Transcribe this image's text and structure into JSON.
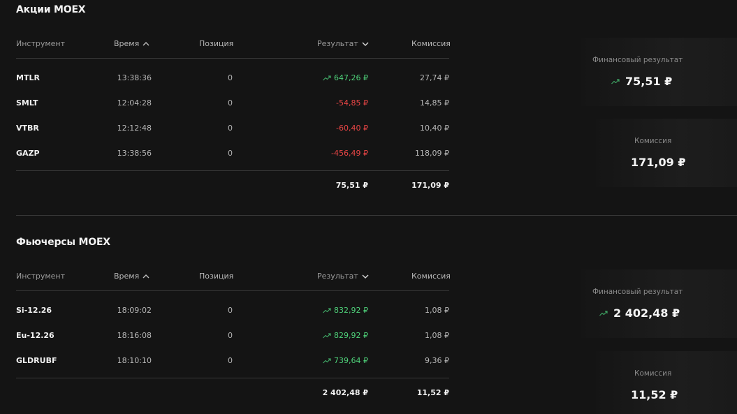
{
  "colors": {
    "positive": "#4fd27a",
    "negative": "#ec4646",
    "background": "#141414"
  },
  "icons": {
    "trend": "trend-up-icon",
    "sort_up": "chevron-up-icon",
    "sort_down": "chevron-down-icon"
  },
  "sections": [
    {
      "title": "Акции MOEX",
      "headers": {
        "instrument": "Инструмент",
        "time": "Время",
        "position": "Позиция",
        "result": "Результат",
        "commission": "Комиссия"
      },
      "rows": [
        {
          "instrument": "MTLR",
          "time": "13:38:36",
          "position": "0",
          "result": "647,26 ₽",
          "sign": "pos",
          "commission": "27,74 ₽"
        },
        {
          "instrument": "SMLT",
          "time": "12:04:28",
          "position": "0",
          "result": "-54,85 ₽",
          "sign": "neg",
          "commission": "14,85 ₽"
        },
        {
          "instrument": "VTBR",
          "time": "12:12:48",
          "position": "0",
          "result": "-60,40 ₽",
          "sign": "neg",
          "commission": "10,40 ₽"
        },
        {
          "instrument": "GAZP",
          "time": "13:38:56",
          "position": "0",
          "result": "-456,49 ₽",
          "sign": "neg",
          "commission": "118,09 ₽"
        }
      ],
      "totals": {
        "result": "75,51 ₽",
        "commission": "171,09 ₽"
      },
      "cards": {
        "fin_label": "Финансовый результат",
        "fin_value": "75,51 ₽",
        "com_label": "Комиссия",
        "com_value": "171,09 ₽"
      }
    },
    {
      "title": "Фьючерсы MOEX",
      "headers": {
        "instrument": "Инструмент",
        "time": "Время",
        "position": "Позиция",
        "result": "Результат",
        "commission": "Комиссия"
      },
      "rows": [
        {
          "instrument": "Si-12.26",
          "time": "18:09:02",
          "position": "0",
          "result": "832,92 ₽",
          "sign": "pos",
          "commission": "1,08 ₽"
        },
        {
          "instrument": "Eu-12.26",
          "time": "18:16:08",
          "position": "0",
          "result": "829,92 ₽",
          "sign": "pos",
          "commission": "1,08 ₽"
        },
        {
          "instrument": "GLDRUBF",
          "time": "18:10:10",
          "position": "0",
          "result": "739,64 ₽",
          "sign": "pos",
          "commission": "9,36 ₽"
        }
      ],
      "totals": {
        "result": "2 402,48 ₽",
        "commission": "11,52 ₽"
      },
      "cards": {
        "fin_label": "Финансовый результат",
        "fin_value": "2 402,48 ₽",
        "com_label": "Комиссия",
        "com_value": "11,52 ₽"
      }
    }
  ]
}
